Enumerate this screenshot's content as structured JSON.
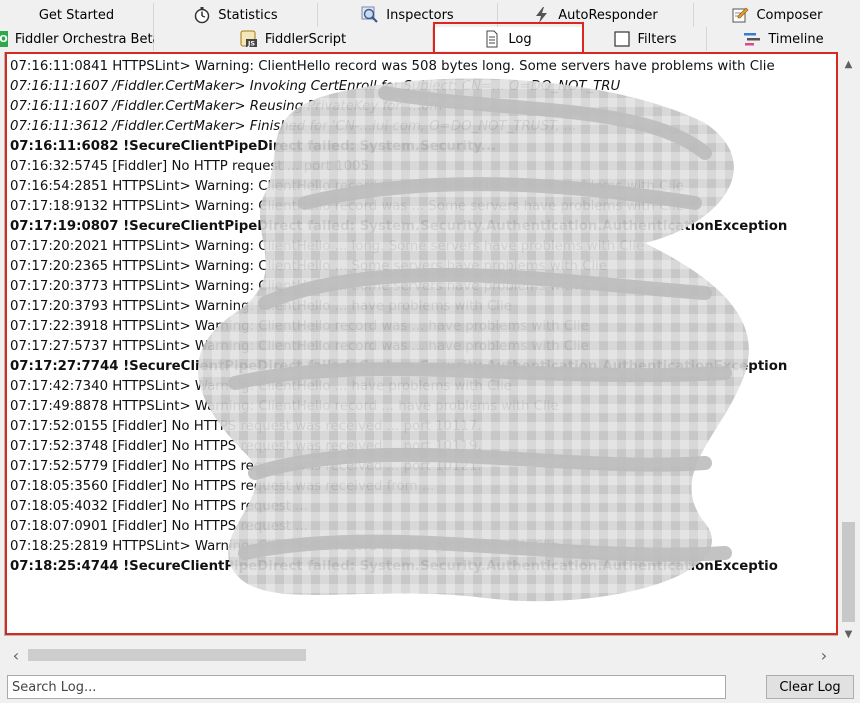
{
  "tabs_row1": [
    {
      "label": "Get Started",
      "icon": "none"
    },
    {
      "label": "Statistics",
      "icon": "stopwatch-icon"
    },
    {
      "label": "Inspectors",
      "icon": "magnifier-icon"
    },
    {
      "label": "AutoResponder",
      "icon": "lightning-icon"
    },
    {
      "label": "Composer",
      "icon": "pencil-icon"
    }
  ],
  "tabs_row2": [
    {
      "label": "Fiddler Orchestra Beta",
      "icon": "fo-badge-icon",
      "badge": "FO"
    },
    {
      "label": "FiddlerScript",
      "icon": "script-js-icon",
      "badge": "JS"
    },
    {
      "label": "Log",
      "icon": "document-icon",
      "selected": true
    },
    {
      "label": "Filters",
      "icon": "checkbox-icon"
    },
    {
      "label": "Timeline",
      "icon": "timeline-icon"
    }
  ],
  "log_lines": [
    {
      "text": "07:16:11:0841 HTTPSLint> Warning: ClientHello record was 508 bytes long. Some servers have problems with Clie",
      "style": "normal"
    },
    {
      "text": "07:16:11:1607 /Fiddler.CertMaker> Invoking CertEnroll for Subject: CN=... O=DO_NOT_TRU",
      "style": "italic"
    },
    {
      "text": "07:16:11:1607 /Fiddler.CertMaker> Reusing PrivateKey for '...om'",
      "style": "italic"
    },
    {
      "text": "07:16:11:3612 /Fiddler.CertMaker> Finished for 'CN-...iui com, O=DO_NOT_TRUST, ...",
      "style": "italic"
    },
    {
      "text": "07:16:11:6082 !SecureClientPipeDirect failed: System.Security...",
      "style": "bold"
    },
    {
      "text": "07:16:32:5745 [Fiddler] No HTTP request ... port 1005",
      "style": "normal"
    },
    {
      "text": "07:16:54:2851 HTTPSLint> Warning: ClientHello record was ... Some servers have problems with Clie",
      "style": "normal"
    },
    {
      "text": "07:17:18:9132 HTTPSLint> Warning: ClientHello record was ... Some servers have problems with Clie",
      "style": "normal"
    },
    {
      "text": "07:17:19:0807 !SecureClientPipeDirect failed: System.Security.Authentication.AuthenticationException",
      "style": "bold"
    },
    {
      "text": "07:17:20:2021 HTTPSLint> Warning: ClientHello ... long. Some servers have problems with Clie",
      "style": "normal"
    },
    {
      "text": "07:17:20:2365 HTTPSLint> Warning: ClientHello ... Some servers have problems with Clie",
      "style": "normal"
    },
    {
      "text": "07:17:20:3773 HTTPSLint> Warning: ClientHello ... Some servers have problems with Clie",
      "style": "normal"
    },
    {
      "text": "07:17:20:3793 HTTPSLint> Warning: ClientHello ... have problems with Clie",
      "style": "normal"
    },
    {
      "text": "07:17:22:3918 HTTPSLint> Warning: ClientHello record was ... have problems with Clie",
      "style": "normal"
    },
    {
      "text": "07:17:27:5737 HTTPSLint> Warning: ClientHello record was ... have problems with Clie",
      "style": "normal"
    },
    {
      "text": "07:17:27:7744 !SecureClientPipeDirect failed: System.Security.Authentication.AuthenticationException",
      "style": "bold"
    },
    {
      "text": "07:17:42:7340 HTTPSLint> Warning: ClientHello ... have problems with Clie",
      "style": "normal"
    },
    {
      "text": "07:17:49:8878 HTTPSLint> Warning: ClientHello record ... have problems with Clie",
      "style": "normal"
    },
    {
      "text": "07:17:52:0155 [Fiddler] No HTTPS request was received ... port 10117.",
      "style": "normal"
    },
    {
      "text": "07:17:52:3748 [Fiddler] No HTTPS request was received ... port 10119.",
      "style": "normal"
    },
    {
      "text": "07:17:52:5779 [Fiddler] No HTTPS request was received ... port 10121.",
      "style": "normal"
    },
    {
      "text": "07:18:05:3560 [Fiddler] No HTTPS request was received from ...",
      "style": "normal"
    },
    {
      "text": "07:18:05:4032 [Fiddler] No HTTPS request ...",
      "style": "normal"
    },
    {
      "text": "07:18:07:0901 [Fiddler] No HTTPS request ...",
      "style": "normal"
    },
    {
      "text": "07:18:25:2819 HTTPSLint> Warning: ClientHello record ... have problems with Clie",
      "style": "normal"
    },
    {
      "text": "07:18:25:4744 !SecureClientPipeDirect failed: System.Security.Authentication.AuthenticationExceptio",
      "style": "bold"
    }
  ],
  "search": {
    "placeholder": "Search Log...",
    "value": ""
  },
  "clear_button": {
    "label": "Clear Log"
  },
  "colors": {
    "highlight": "#e0261c",
    "fo_badge": "#2ea84a"
  }
}
